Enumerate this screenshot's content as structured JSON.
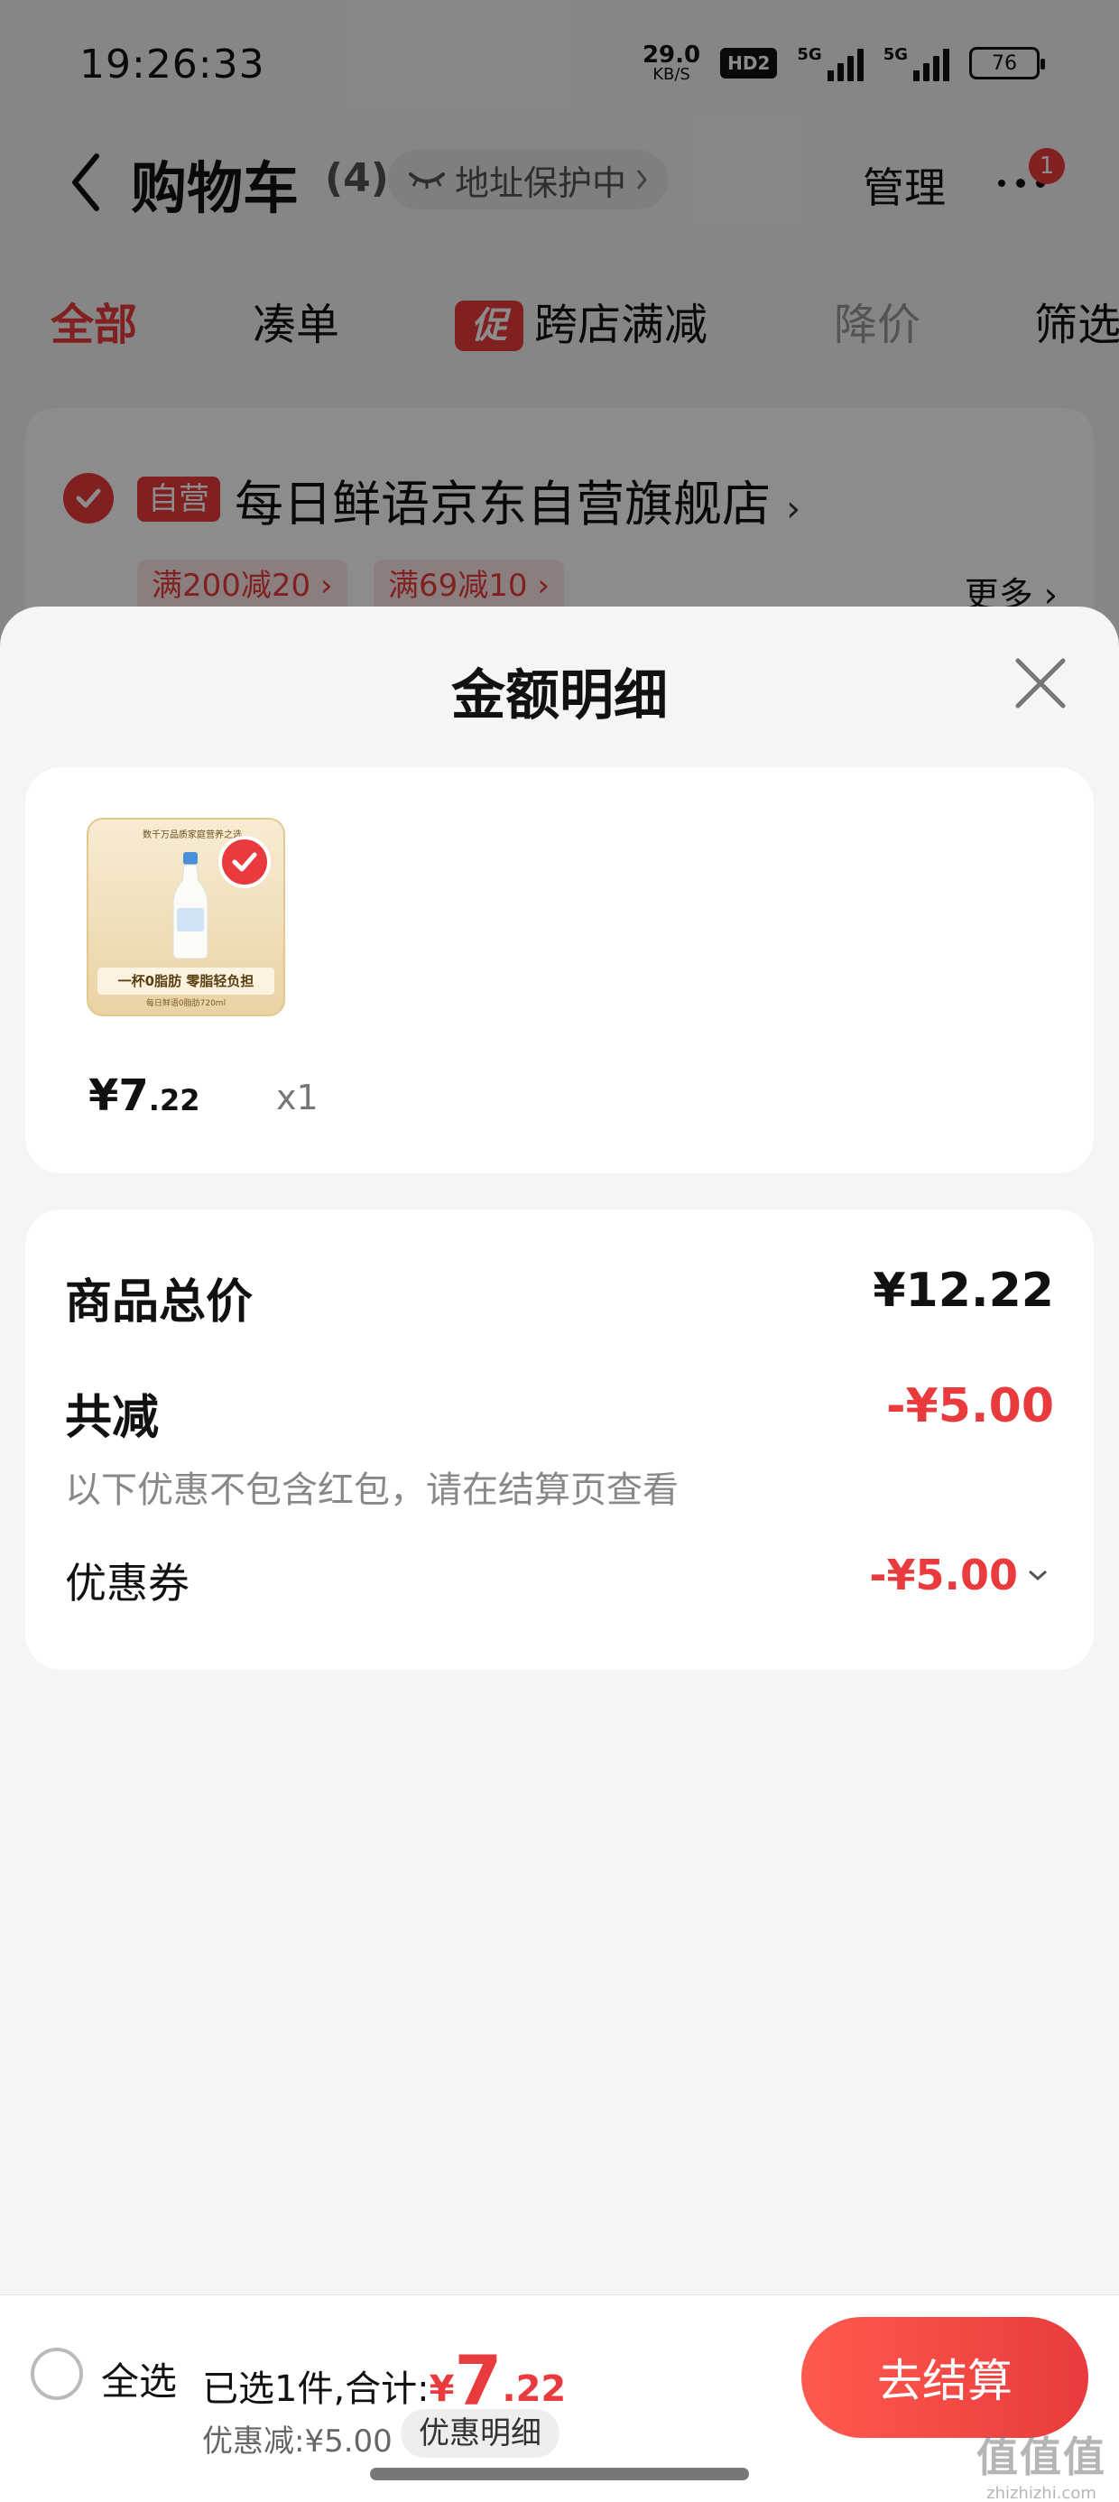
{
  "status_bar": {
    "time": "19:26:33",
    "net_speed_value": "29.0",
    "net_speed_unit": "KB/S",
    "hd_badge": "HD2",
    "signal1_label": "5G",
    "signal2_label": "5G",
    "battery": "76"
  },
  "header": {
    "title": "购物车",
    "count": "(4)",
    "address_pill": "地址保护中",
    "manage": "管理",
    "notification_count": "1"
  },
  "tabs": [
    {
      "label": "全部",
      "state": "active"
    },
    {
      "label": "凑单",
      "state": "normal"
    },
    {
      "label": "跨店满减",
      "state": "normal",
      "tag": "促"
    },
    {
      "label": "降价",
      "state": "disabled"
    },
    {
      "label": "筛选",
      "state": "normal"
    }
  ],
  "store": {
    "tag": "自营",
    "name": "每日鲜语京东自营旗舰店",
    "promos": [
      "满200减20",
      "满69减10"
    ],
    "more": "更多"
  },
  "sheet": {
    "title": "金额明细",
    "product": {
      "image_banner": "数千万品质家庭营养之选",
      "image_slogan": "一杯0脂肪 零脂轻负担",
      "image_sub": "每日鲜语0脂肪720ml",
      "price_int": "¥7",
      "price_dec": ".22",
      "qty": "x1"
    },
    "total_label": "商品总价",
    "total_value": "¥12.22",
    "reduce_label": "共减",
    "reduce_value": "-¥5.00",
    "note": "以下优惠不包含红包，请在结算页查看",
    "coupon_label": "优惠券",
    "coupon_value": "-¥5.00"
  },
  "checkout": {
    "select_all": "全选",
    "summary_prefix": "已选1件,合计:",
    "currency": "¥",
    "total_int": "7",
    "total_dec": ".22",
    "discount_line": "优惠减:¥5.00",
    "detail_button": "优惠明细",
    "checkout_button": "去结算"
  },
  "watermark": {
    "main": "值值值",
    "sub": "zhizhizhi.com"
  },
  "colors": {
    "accent": "#e93b3d",
    "background": "#f5f5f5"
  }
}
